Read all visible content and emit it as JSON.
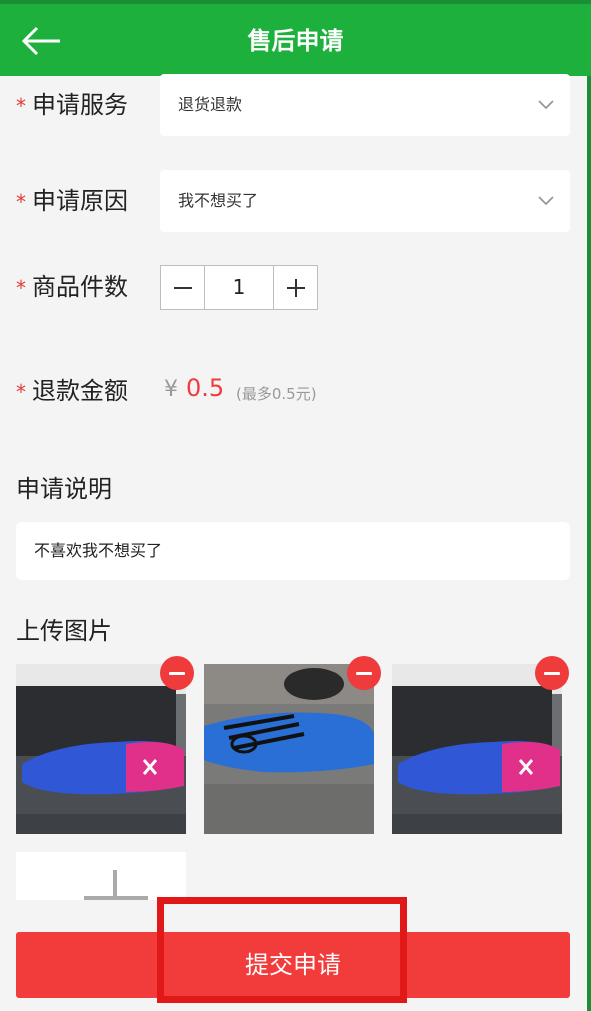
{
  "header": {
    "title": "售后申请"
  },
  "form": {
    "service": {
      "label": "申请服务",
      "value": "退货退款"
    },
    "reason": {
      "label": "申请原因",
      "value": "我不想买了"
    },
    "quantity": {
      "label": "商品件数",
      "value": "1"
    },
    "refund": {
      "label": "退款金额",
      "currency": "¥",
      "amount": "0.5",
      "max_note": "(最多0.5元)"
    },
    "required_mark": "*"
  },
  "description": {
    "label": "申请说明",
    "value": "不喜欢我不想买了"
  },
  "upload": {
    "label": "上传图片",
    "images": [
      "shoe-photo-1",
      "shoe-photo-2",
      "shoe-photo-3"
    ]
  },
  "submit": {
    "label": "提交申请"
  },
  "colors": {
    "header_green": "#1eb03c",
    "accent_red": "#f23c3c"
  }
}
